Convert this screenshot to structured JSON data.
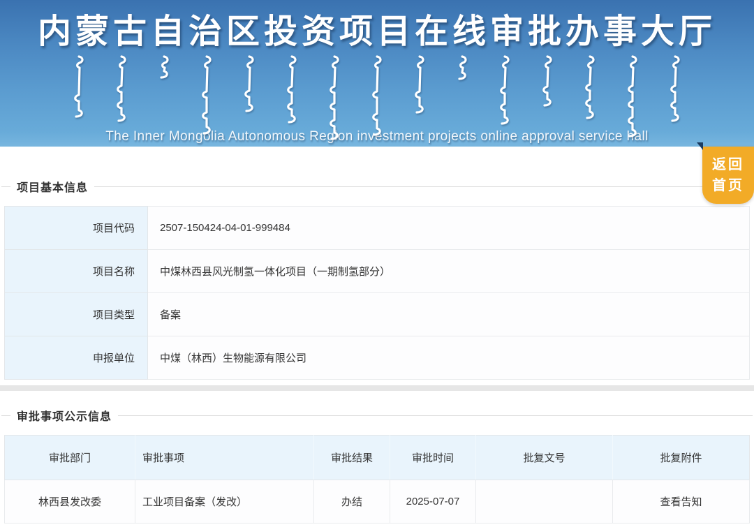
{
  "header": {
    "title_cn": "内蒙古自治区投资项目在线审批办事大厅",
    "subtitle_en": "The Inner Mongolia Autonomous Region investment projects online approval service hall",
    "mongolian_glyph_heights": [
      92,
      98,
      36,
      116,
      84,
      100,
      124,
      118,
      86,
      38,
      102,
      76,
      94,
      120,
      98
    ],
    "bg_top": "#3a72b0",
    "bg_bottom": "#78b6df"
  },
  "return_button": {
    "label": "返回\n首页",
    "bg": "#f2ab27"
  },
  "section1": {
    "title": "项目基本信息",
    "rows": [
      {
        "label": "项目代码",
        "value": "2507-150424-04-01-999484"
      },
      {
        "label": "项目名称",
        "value": "中煤林西县风光制氢一体化项目（一期制氢部分）"
      },
      {
        "label": "项目类型",
        "value": "备案"
      },
      {
        "label": "申报单位",
        "value": "中煤（林西）生物能源有限公司"
      }
    ]
  },
  "section2": {
    "title": "审批事项公示信息",
    "columns": [
      "审批部门",
      "审批事项",
      "审批结果",
      "审批时间",
      "批复文号",
      "批复附件"
    ],
    "rows": [
      [
        "林西县发改委",
        "工业项目备案（发改）",
        "办结",
        "2025-07-07",
        "",
        "查看告知"
      ]
    ]
  },
  "colors": {
    "accent_orange": "#f2ab27",
    "label_cell_bg": "#e9f4fc",
    "banner_blue_top": "#3a72b0",
    "banner_blue_bottom": "#78b6df"
  }
}
